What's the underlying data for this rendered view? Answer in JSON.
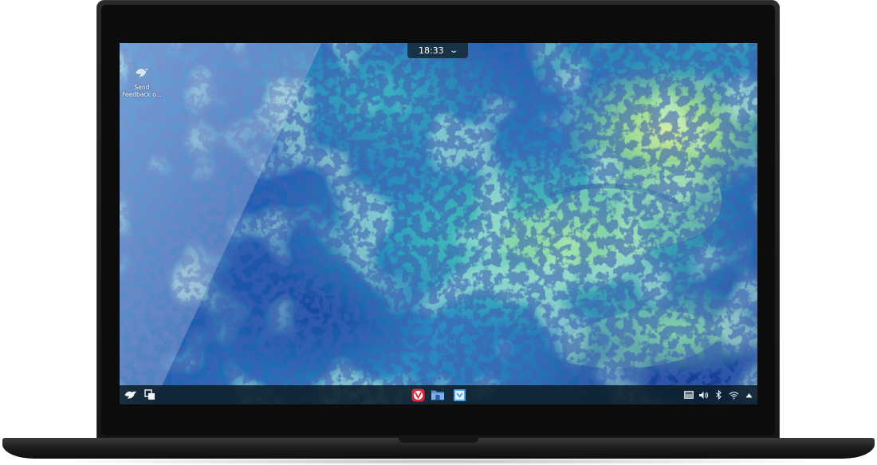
{
  "device": "laptop",
  "clock": {
    "time": "18:33",
    "chevron_icon": "chevron-down-icon"
  },
  "desktop": {
    "icons": [
      {
        "label": "Send Feedback o...",
        "icon": "bird-icon"
      }
    ]
  },
  "taskbar": {
    "left": [
      {
        "icon": "bird-launcher-icon"
      },
      {
        "icon": "multitask-view-icon"
      }
    ],
    "center_apps": [
      {
        "icon": "vivaldi-browser-icon",
        "color": "#e2263a"
      },
      {
        "icon": "file-manager-icon",
        "color": "#5b8fd6"
      },
      {
        "icon": "app-store-icon",
        "color": "#3c9ee8"
      }
    ],
    "tray": [
      {
        "icon": "keyboard-layout-icon"
      },
      {
        "icon": "volume-icon"
      },
      {
        "icon": "bluetooth-icon"
      },
      {
        "icon": "wifi-icon"
      },
      {
        "icon": "expand-tray-icon"
      }
    ]
  },
  "colors": {
    "taskbar_bg": "#0c1e28",
    "wallpaper_primary": "#2b78c8",
    "wallpaper_accent": "#d8ee9a"
  }
}
